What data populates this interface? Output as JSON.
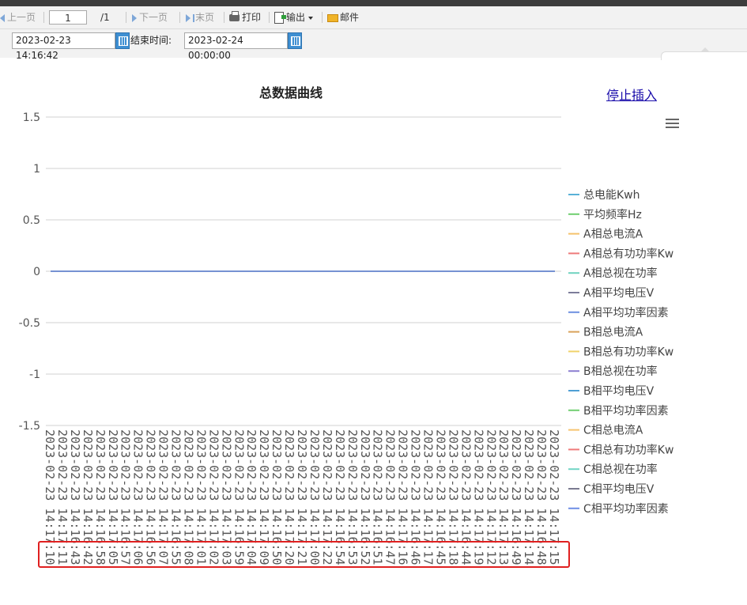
{
  "toolbar": {
    "prev_label": "上一页",
    "page_value": "1",
    "page_total": "/1",
    "next_label": "下一页",
    "last_label": "末页",
    "print_label": "打印",
    "export_label": "输出",
    "mail_label": "邮件"
  },
  "filter": {
    "start_value": "2023-02-23 14:16:42",
    "end_label": "结束时间:",
    "end_value": "2023-02-24 00:00:00"
  },
  "stop_insert_label": "停止插入",
  "icons": [
    "triangle-left-icon",
    "triangle-right-icon",
    "last-page-icon",
    "printer-icon",
    "export-icon",
    "mail-icon",
    "calendar-icon",
    "menu-icon"
  ],
  "chart_data": {
    "type": "line",
    "title": "总数据曲线",
    "ylim": [
      -1.5,
      1.5
    ],
    "yticks": [
      "1.5",
      "1",
      "0.5",
      "0",
      "-0.5",
      "-1",
      "-1.5"
    ],
    "grid": true,
    "legend_position": "right",
    "categories": [
      "2023-02-23 14:17:10",
      "2023-02-23 14:17:11",
      "2023-02-23 14:16:43",
      "2023-02-23 14:16:42",
      "2023-02-23 14:16:58",
      "2023-02-23 14:17:05",
      "2023-02-23 14:16:57",
      "2023-02-23 14:17:06",
      "2023-02-23 14:16:56",
      "2023-02-23 14:17:07",
      "2023-02-23 14:16:55",
      "2023-02-23 14:17:08",
      "2023-02-23 14:17:01",
      "2023-02-23 14:17:02",
      "2023-02-23 14:17:03",
      "2023-02-23 14:16:59",
      "2023-02-23 14:17:04",
      "2023-02-23 14:17:09",
      "2023-02-23 14:16:50",
      "2023-02-23 14:17:20",
      "2023-02-23 14:17:21",
      "2023-02-23 14:17:00",
      "2023-02-23 14:17:22",
      "2023-02-23 14:16:54",
      "2023-02-23 14:16:53",
      "2023-02-23 14:16:52",
      "2023-02-23 14:16:51",
      "2023-02-23 14:16:47",
      "2023-02-23 14:17:16",
      "2023-02-23 14:16:46",
      "2023-02-23 14:17:17",
      "2023-02-23 14:16:45",
      "2023-02-23 14:17:18",
      "2023-02-23 14:16:44",
      "2023-02-23 14:17:19",
      "2023-02-23 14:17:12",
      "2023-02-23 14:17:13",
      "2023-02-23 14:16:49",
      "2023-02-23 14:17:14",
      "2023-02-23 14:16:48",
      "2023-02-23 14:17:15"
    ],
    "series": [
      {
        "name": "总电能Kwh",
        "color": "#5ab1d8",
        "value": 0
      },
      {
        "name": "平均频率Hz",
        "color": "#6fcf6f",
        "value": 0
      },
      {
        "name": "A相总电流A",
        "color": "#f5c26b",
        "value": 0
      },
      {
        "name": "A相总有功功率Kw",
        "color": "#ee7a7a",
        "value": 0
      },
      {
        "name": "A相总视在功率",
        "color": "#6fd3c0",
        "value": 0
      },
      {
        "name": "A相平均电压V",
        "color": "#7d7d9a",
        "value": 0
      },
      {
        "name": "A相平均功率因素",
        "color": "#6d8fe0",
        "value": 0
      },
      {
        "name": "B相总电流A",
        "color": "#d9a25a",
        "value": 0
      },
      {
        "name": "B相总有功功率Kw",
        "color": "#f0d36b",
        "value": 0
      },
      {
        "name": "B相总视在功率",
        "color": "#8c7fd0",
        "value": 0
      },
      {
        "name": "B相平均电压V",
        "color": "#4f9fd4",
        "value": 0
      },
      {
        "name": "B相平均功率因素",
        "color": "#72cf72",
        "value": 0
      },
      {
        "name": "C相总电流A",
        "color": "#f6c46f",
        "value": 0
      },
      {
        "name": "C相总有功功率Kw",
        "color": "#ef7b7b",
        "value": 0
      },
      {
        "name": "C相总视在功率",
        "color": "#72d5c5",
        "value": 0
      },
      {
        "name": "C相平均电压V",
        "color": "#7a7a90",
        "value": 0
      },
      {
        "name": "C相平均功率因素",
        "color": "#6f8fe6",
        "value": 0
      }
    ]
  }
}
